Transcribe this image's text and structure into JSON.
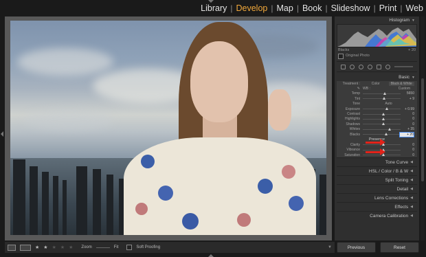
{
  "modules": [
    "Library",
    "Develop",
    "Map",
    "Book",
    "Slideshow",
    "Print",
    "Web"
  ],
  "active_module": "Develop",
  "histogram": {
    "title": "Histogram",
    "left_label": "Blacks",
    "right_label": "+ 20",
    "checkbox_label": "Original Photo"
  },
  "basic": {
    "title": "Basic",
    "treatment_label": "Treatment :",
    "treatment_color": "Color",
    "treatment_bw": "Black & White",
    "wb_label": "WB :",
    "wb_value": "Custom",
    "temp_label": "Temp",
    "temp_value": "5650",
    "tint_label": "Tint",
    "tint_value": "+ 9",
    "tone_label": "Tone",
    "tone_auto": "Auto",
    "exposure_label": "Exposure",
    "exposure_value": "+ 0.99",
    "contrast_label": "Contrast",
    "contrast_value": "0",
    "highlights_label": "Highlights",
    "highlights_value": "0",
    "shadows_label": "Shadows",
    "shadows_value": "0",
    "whites_label": "Whites",
    "whites_value": "+ 35",
    "blacks_label": "Blacks",
    "blacks_value": "+ 20",
    "presence_label": "Presence",
    "clarity_label": "Clarity",
    "clarity_value": "0",
    "vibrance_label": "Vibrance",
    "vibrance_value": "0",
    "saturation_label": "Saturation",
    "saturation_value": "0"
  },
  "panels": [
    "Tone Curve",
    "HSL / Color / B&W",
    "Split Toning",
    "Detail",
    "Lens Corrections",
    "Effects",
    "Camera Calibration"
  ],
  "hsl": {
    "hsl": "HSL",
    "sep1": " / ",
    "color": "Color",
    "sep2": " / ",
    "bw": "B & W"
  },
  "toolbar": {
    "zoom_label": "Zoom",
    "zoom_value": "Fit",
    "soft_proofing": "Soft Proofing"
  },
  "buttons": {
    "previous": "Previous",
    "reset": "Reset"
  },
  "accent_color": "#f2a93b"
}
